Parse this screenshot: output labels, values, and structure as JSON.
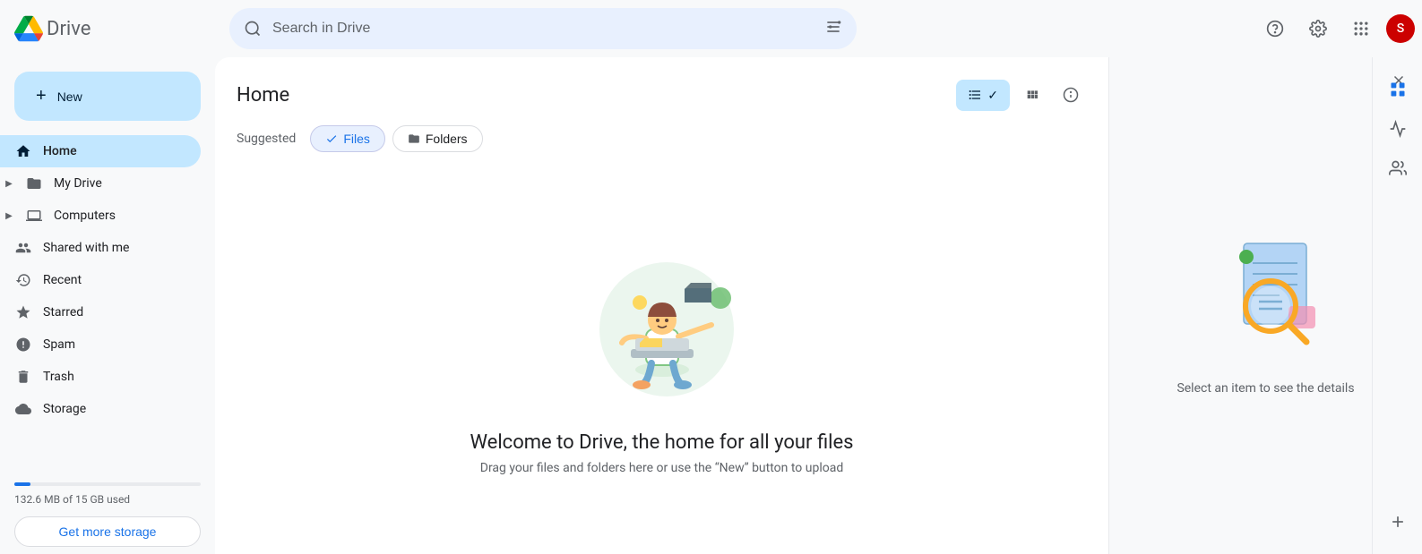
{
  "app": {
    "title": "Drive",
    "logo_alt": "Google Drive"
  },
  "topbar": {
    "search_placeholder": "Search in Drive",
    "help_icon": "?",
    "settings_icon": "⚙",
    "apps_icon": "⊞",
    "avatar_initial": "S"
  },
  "sidebar": {
    "new_button_label": "New",
    "nav_items": [
      {
        "id": "home",
        "label": "Home",
        "icon": "home",
        "active": true
      },
      {
        "id": "my-drive",
        "label": "My Drive",
        "icon": "folder",
        "expandable": true
      },
      {
        "id": "computers",
        "label": "Computers",
        "icon": "computer",
        "expandable": true
      },
      {
        "id": "shared-with-me",
        "label": "Shared with me",
        "icon": "people"
      },
      {
        "id": "recent",
        "label": "Recent",
        "icon": "clock"
      },
      {
        "id": "starred",
        "label": "Starred",
        "icon": "star"
      },
      {
        "id": "spam",
        "label": "Spam",
        "icon": "spam"
      },
      {
        "id": "trash",
        "label": "Trash",
        "icon": "trash"
      },
      {
        "id": "storage",
        "label": "Storage",
        "icon": "cloud"
      }
    ],
    "storage": {
      "used_text": "132.6 MB of 15 GB used",
      "get_more_label": "Get more storage",
      "percent": 8.8
    }
  },
  "content": {
    "page_title": "Home",
    "suggested_label": "Suggested",
    "filter_tabs": [
      {
        "id": "files",
        "label": "Files",
        "active": true,
        "icon": "check"
      },
      {
        "id": "folders",
        "label": "Folders",
        "active": false,
        "icon": "folder-outline"
      }
    ],
    "view_list_label": "List view",
    "view_grid_label": "Grid view",
    "welcome_title": "Welcome to Drive, the home for all your files",
    "welcome_subtitle": "Drag your files and folders here or use the “New” button to upload"
  },
  "right_panel": {
    "select_item_text": "Select an item to see the details",
    "close_icon": "✕",
    "add_icon": "+"
  }
}
